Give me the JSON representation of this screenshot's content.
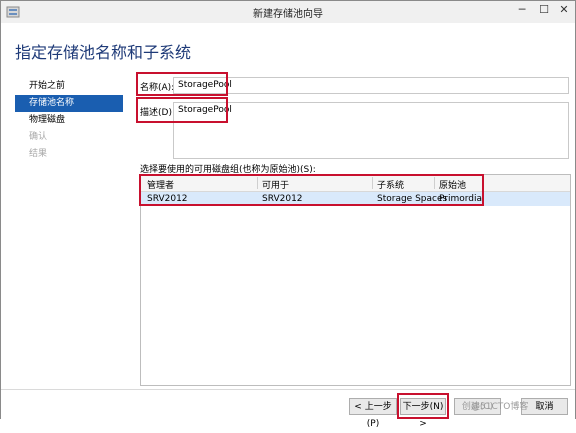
{
  "window": {
    "title": "新建存储池向导",
    "controls": {
      "minimize": "─",
      "maximize": "☐",
      "close": "✕"
    }
  },
  "page": {
    "heading": "指定存储池名称和子系统"
  },
  "nav": {
    "items": [
      {
        "label": "开始之前",
        "state": "normal"
      },
      {
        "label": "存储池名称",
        "state": "active"
      },
      {
        "label": "物理磁盘",
        "state": "normal"
      },
      {
        "label": "确认",
        "state": "disabled"
      },
      {
        "label": "结果",
        "state": "disabled"
      }
    ]
  },
  "form": {
    "name_label": "名称(A):",
    "name_value": "StoragePool",
    "desc_label": "描述(D):",
    "desc_value": "StoragePool",
    "group_label": "选择要使用的可用磁盘组(也称为原始池)(S):"
  },
  "table": {
    "columns": [
      "管理者",
      "可用于",
      "子系统",
      "原始池"
    ],
    "rows": [
      [
        "SRV2012",
        "SRV2012",
        "Storage Spaces",
        "Primordial"
      ]
    ]
  },
  "footer": {
    "prev": "< 上一步(P)",
    "next": "下一步(N) >",
    "create": "创建(C)",
    "cancel": "取消"
  },
  "watermark": "@51CTO博客",
  "colors": {
    "accent": "#1a5eb0",
    "heading": "#1e3a78",
    "highlight": "#c8102e"
  }
}
